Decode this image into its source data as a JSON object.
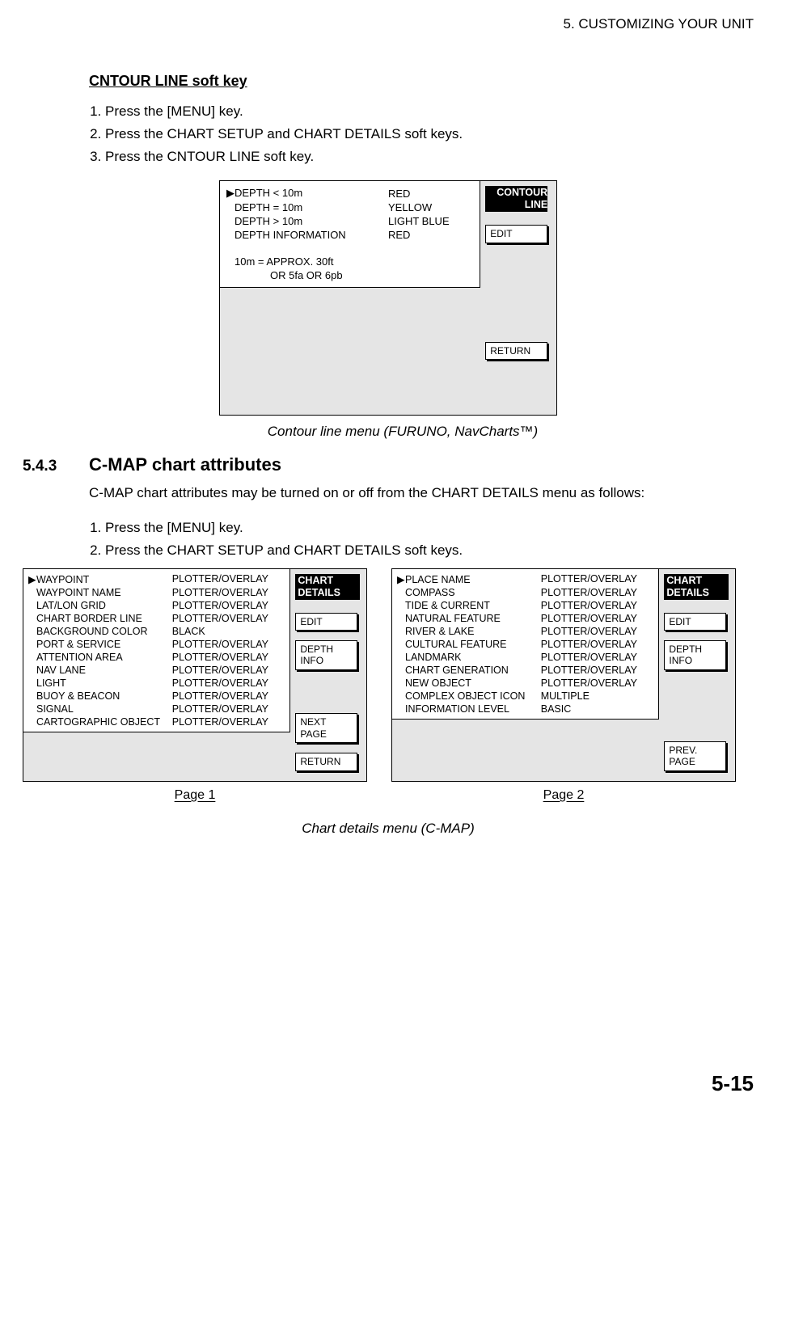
{
  "chapter_header": "5. CUSTOMIZING YOUR UNIT",
  "section1": {
    "title": "CNTOUR LINE soft key",
    "steps": [
      "Press the [MENU] key.",
      "Press the CHART SETUP and CHART DETAILS soft keys.",
      "Press the CNTOUR LINE soft key."
    ]
  },
  "fig1": {
    "rows": [
      {
        "a": "DEPTH < 10m",
        "b": "RED",
        "sel": true
      },
      {
        "a": "DEPTH = 10m",
        "b": "YELLOW",
        "sel": false
      },
      {
        "a": "DEPTH > 10m",
        "b": "LIGHT BLUE",
        "sel": false
      },
      {
        "a": "DEPTH INFORMATION",
        "b": "RED",
        "sel": false
      }
    ],
    "note1": "10m = APPROX. 30ft",
    "note2": "OR 5fa OR 6pb",
    "softkey_title": "CONTOUR\nLINE",
    "btn_edit": "EDIT",
    "btn_return": "RETURN",
    "caption": "Contour line menu (FURUNO, NavCharts™)"
  },
  "section2": {
    "num": "5.4.3",
    "title": "C-MAP chart attributes",
    "para": "C-MAP chart attributes may be turned on or off from the CHART DETAILS menu as follows:",
    "steps": [
      "Press the [MENU] key.",
      "Press the CHART SETUP and CHART DETAILS soft keys."
    ]
  },
  "fig2a": {
    "rows": [
      {
        "a": "WAYPOINT",
        "b": "PLOTTER/OVERLAY",
        "sel": true
      },
      {
        "a": "WAYPOINT NAME",
        "b": "PLOTTER/OVERLAY",
        "sel": false
      },
      {
        "a": "LAT/LON GRID",
        "b": "PLOTTER/OVERLAY",
        "sel": false
      },
      {
        "a": "CHART BORDER LINE",
        "b": "PLOTTER/OVERLAY",
        "sel": false
      },
      {
        "a": "BACKGROUND COLOR",
        "b": "BLACK",
        "sel": false
      },
      {
        "a": "PORT & SERVICE",
        "b": "PLOTTER/OVERLAY",
        "sel": false
      },
      {
        "a": "ATTENTION AREA",
        "b": "PLOTTER/OVERLAY",
        "sel": false
      },
      {
        "a": "NAV LANE",
        "b": "PLOTTER/OVERLAY",
        "sel": false
      },
      {
        "a": "LIGHT",
        "b": "PLOTTER/OVERLAY",
        "sel": false
      },
      {
        "a": "BUOY & BEACON",
        "b": "PLOTTER/OVERLAY",
        "sel": false
      },
      {
        "a": "SIGNAL",
        "b": "PLOTTER/OVERLAY",
        "sel": false
      },
      {
        "a": "CARTOGRAPHIC OBJECT",
        "b": "PLOTTER/OVERLAY",
        "sel": false
      }
    ],
    "softkey_title": "CHART\nDETAILS",
    "btn_edit": "EDIT",
    "btn_depth": "DEPTH\nINFO",
    "btn_next": "NEXT\nPAGE",
    "btn_return": "RETURN"
  },
  "fig2b": {
    "rows": [
      {
        "a": "PLACE NAME",
        "b": "PLOTTER/OVERLAY",
        "sel": true
      },
      {
        "a": "COMPASS",
        "b": "PLOTTER/OVERLAY",
        "sel": false
      },
      {
        "a": "TIDE & CURRENT",
        "b": "PLOTTER/OVERLAY",
        "sel": false
      },
      {
        "a": "NATURAL FEATURE",
        "b": "PLOTTER/OVERLAY",
        "sel": false
      },
      {
        "a": "RIVER & LAKE",
        "b": "PLOTTER/OVERLAY",
        "sel": false
      },
      {
        "a": "CULTURAL FEATURE",
        "b": "PLOTTER/OVERLAY",
        "sel": false
      },
      {
        "a": "LANDMARK",
        "b": "PLOTTER/OVERLAY",
        "sel": false
      },
      {
        "a": "CHART GENERATION",
        "b": "PLOTTER/OVERLAY",
        "sel": false
      },
      {
        "a": "NEW OBJECT",
        "b": "PLOTTER/OVERLAY",
        "sel": false
      },
      {
        "a": "COMPLEX OBJECT ICON",
        "b": "MULTIPLE",
        "sel": false
      },
      {
        "a": "INFORMATION LEVEL",
        "b": "BASIC",
        "sel": false
      }
    ],
    "softkey_title": "CHART\nDETAILS",
    "btn_edit": "EDIT",
    "btn_depth": "DEPTH\nINFO",
    "btn_prev": "PREV.\nPAGE"
  },
  "page_labels": {
    "p1": "Page 1",
    "p2": "Page 2"
  },
  "caption2": "Chart details menu (C-MAP)",
  "footer": "5-15"
}
